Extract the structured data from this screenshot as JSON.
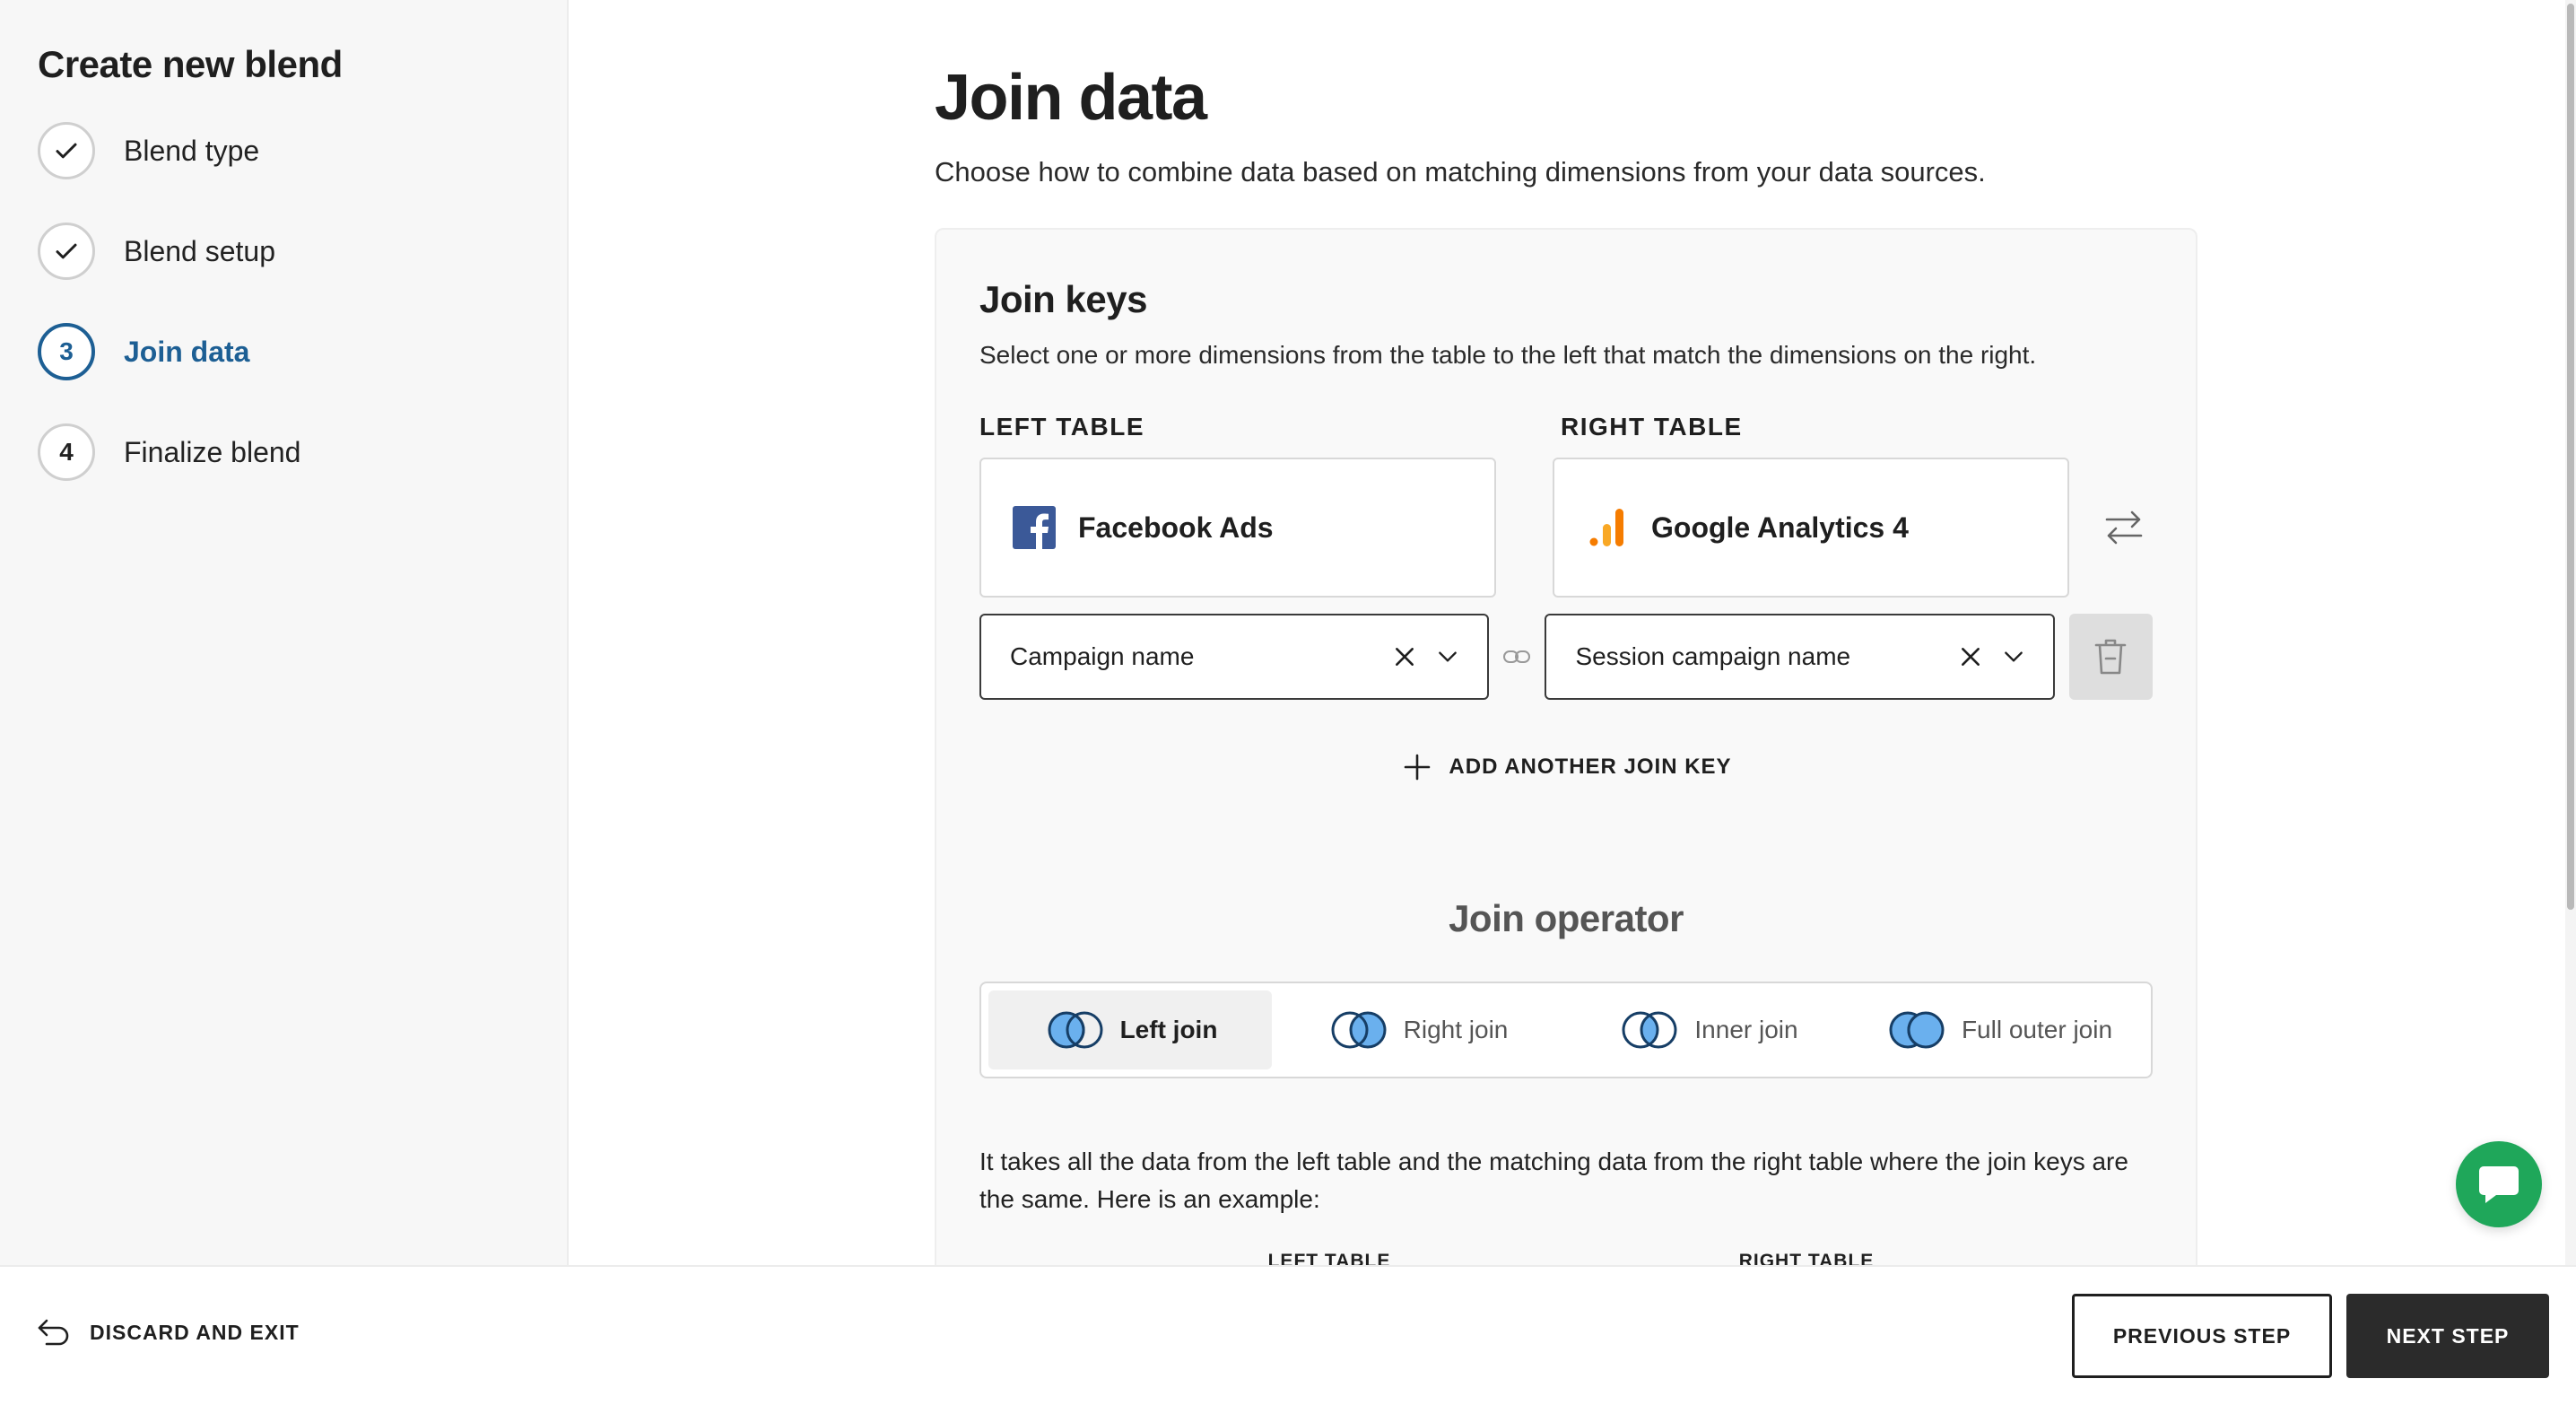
{
  "sidebar": {
    "title": "Create new blend",
    "steps": [
      {
        "marker": "✓",
        "label": "Blend type",
        "state": "done"
      },
      {
        "marker": "✓",
        "label": "Blend setup",
        "state": "done"
      },
      {
        "marker": "3",
        "label": "Join data",
        "state": "active"
      },
      {
        "marker": "4",
        "label": "Finalize blend",
        "state": "pending"
      }
    ]
  },
  "main": {
    "title": "Join data",
    "subtitle": "Choose how to combine data based on matching dimensions from your data sources."
  },
  "join_keys": {
    "title": "Join keys",
    "description": "Select one or more dimensions from the table to the left that match the dimensions on the right.",
    "left_label": "LEFT TABLE",
    "right_label": "RIGHT TABLE",
    "left_source": {
      "name": "Facebook Ads",
      "icon": "facebook-icon"
    },
    "right_source": {
      "name": "Google Analytics 4",
      "icon": "google-analytics-icon"
    },
    "left_key_value": "Campaign name",
    "right_key_value": "Session campaign name",
    "add_key_label": "ADD ANOTHER JOIN KEY"
  },
  "join_operator": {
    "title": "Join operator",
    "options": [
      {
        "label": "Left join",
        "selected": true
      },
      {
        "label": "Right join",
        "selected": false
      },
      {
        "label": "Inner join",
        "selected": false
      },
      {
        "label": "Full outer join",
        "selected": false
      }
    ],
    "explanation": "It takes all the data from the left table and the matching data from the right table where the join keys are the same. Here is an example:",
    "example_left_header": "LEFT TABLE",
    "example_right_header": "RIGHT TABLE"
  },
  "footer": {
    "discard_label": "DISCARD AND EXIT",
    "previous_label": "PREVIOUS STEP",
    "next_label": "NEXT STEP"
  },
  "colors": {
    "accent": "#1d5f94",
    "facebook": "#3b5998",
    "ga_orange": "#f57c00",
    "chat_green": "#1fa75a",
    "venn_fill": "#6ab0ee"
  }
}
